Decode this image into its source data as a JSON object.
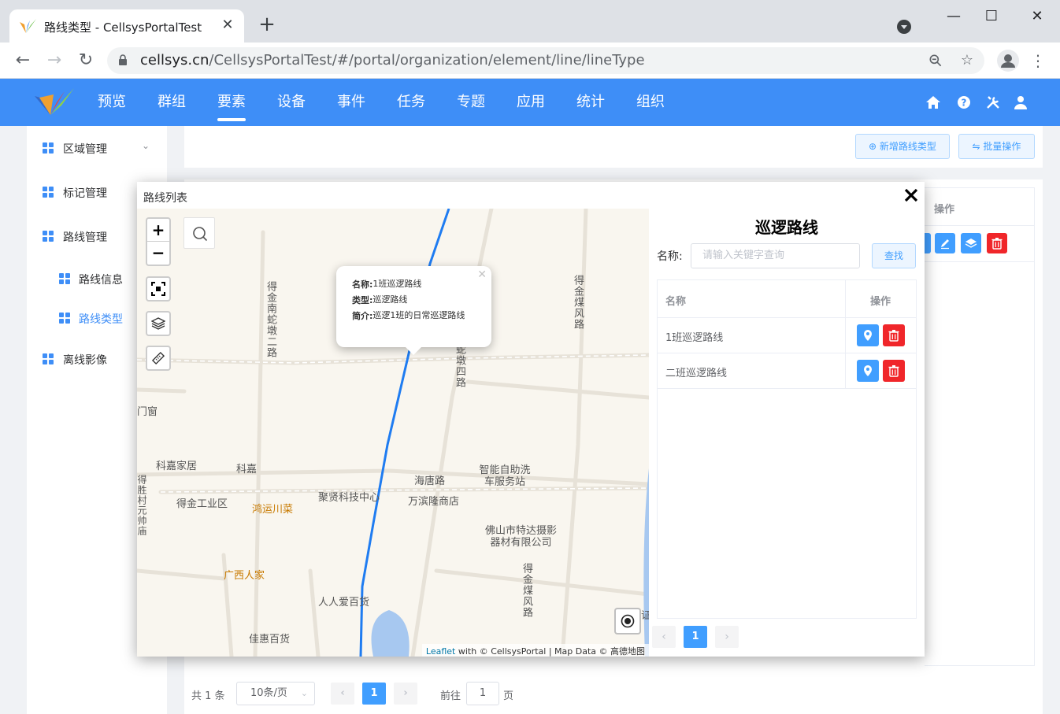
{
  "browser": {
    "tab_title": "路线类型 - CellsysPortalTest",
    "url_host": "cellsys.cn",
    "url_path": "/CellsysPortalTest/#/portal/organization/element/line/lineType"
  },
  "header": {
    "nav": [
      "预览",
      "群组",
      "要素",
      "设备",
      "事件",
      "任务",
      "专题",
      "应用",
      "统计",
      "组织"
    ],
    "active_nav": "要素",
    "accent_color": "#3e8ef7"
  },
  "sidebar": {
    "items": [
      {
        "label": "区域管理"
      },
      {
        "label": "标记管理"
      },
      {
        "label": "路线管理"
      },
      {
        "label": "路线信息"
      },
      {
        "label": "路线类型"
      },
      {
        "label": "离线影像"
      }
    ]
  },
  "toolbar": {
    "add_label": "新增路线类型",
    "batch_label": "批量操作"
  },
  "bg_table": {
    "op_header": "操作"
  },
  "bg_pager": {
    "total": "共 1 条",
    "page_size": "10条/页",
    "current_page": "1",
    "goto_prefix": "前往",
    "goto_value": "1",
    "goto_suffix": "页"
  },
  "modal": {
    "title": "路线列表",
    "popup": {
      "name_label": "名称:",
      "name_value": "1班巡逻路线",
      "type_label": "类型:",
      "type_value": "巡逻路线",
      "desc_label": "简介:",
      "desc_value": "巡逻1班的日常巡逻路线"
    },
    "map_labels": {
      "road1": "得金南蛇墩二路",
      "road2": "得金煤风路",
      "road3": "蛇墩四路",
      "road4": "得金煤风路",
      "road5": "得胜村元帅庙",
      "haitang": "海唐路",
      "kejia": "科嘉家居",
      "kejia2": "科嘉",
      "menchuang": "门窗",
      "industrial": "得金工业区",
      "hongyun": "鸿运川菜",
      "juxian": "聚贤科技中心",
      "wanbin": "万滨隆商店",
      "carwash": "智能自助洗车服务站",
      "camera": "佛山市特达摄影器材有限公司",
      "guangxi": "广西人家",
      "renren": "人人爱百货",
      "jiahui": "佳惠百货",
      "edge": "证"
    },
    "attribution": {
      "leaflet": "Leaflet",
      "rest": "with © CellsysPortal | Map Data © 高德地图"
    },
    "panel": {
      "title": "巡逻路线",
      "name_label": "名称:",
      "search_placeholder": "请输入关键字查询",
      "search_button": "查找",
      "col_name": "名称",
      "col_op": "操作",
      "rows": [
        {
          "name": "1班巡逻路线"
        },
        {
          "name": "二班巡逻路线"
        }
      ],
      "current_page": "1"
    }
  }
}
